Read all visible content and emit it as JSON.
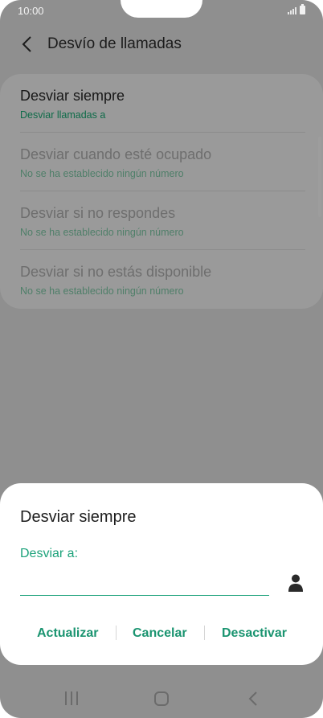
{
  "status_bar": {
    "time": "10:00",
    "icons": [
      "signal-icon",
      "battery-icon"
    ]
  },
  "header": {
    "back_icon": "chevron-left-icon",
    "title": "Desvío de llamadas"
  },
  "call_forward_options": [
    {
      "title": "Desviar siempre",
      "subtitle": "Desviar llamadas a",
      "enabled": true
    },
    {
      "title": "Desviar cuando esté ocupado",
      "subtitle": "No se ha establecido ningún número",
      "enabled": false
    },
    {
      "title": "Desviar si no respondes",
      "subtitle": "No se ha establecido ningún número",
      "enabled": false
    },
    {
      "title": "Desviar si no estás disponible",
      "subtitle": "No se ha establecido ningún número",
      "enabled": false
    }
  ],
  "dialog": {
    "title": "Desviar siempre",
    "field_label": "Desviar a:",
    "field_value": "",
    "contact_icon": "person-icon",
    "buttons": {
      "update": "Actualizar",
      "cancel": "Cancelar",
      "deactivate": "Desactivar"
    }
  },
  "nav_bar": {
    "icons": [
      "recent-apps-icon",
      "home-icon",
      "back-icon"
    ]
  },
  "colors": {
    "accent": "#1ca27a",
    "scrim": "#8f8f8f",
    "dialog_bg": "#ffffff"
  }
}
